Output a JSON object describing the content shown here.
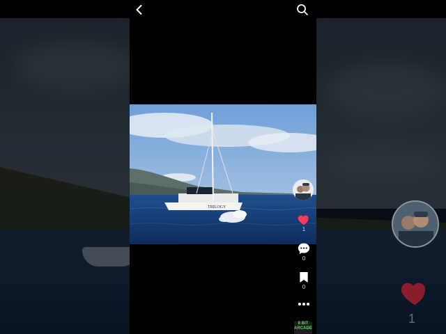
{
  "post": {
    "photo_alt": "Catamaran sailboat on blue ocean with whale splash",
    "boat_name": "TRILOGY",
    "likes": "1",
    "comments": "0",
    "saves": "0"
  },
  "background": {
    "likes": "1"
  },
  "rail": {
    "logo_line1": "8 BIT",
    "logo_line2": "ARCADE"
  },
  "icons": [
    "back-icon",
    "search-icon",
    "heart-icon",
    "comment-icon",
    "bookmark-icon",
    "more-icon"
  ],
  "colors": {
    "heart": "#ff3b5c",
    "bar": "#000000",
    "text": "#ffffff"
  }
}
